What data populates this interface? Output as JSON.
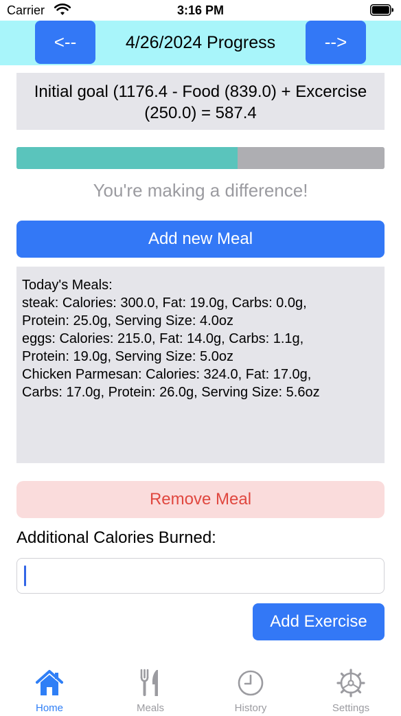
{
  "status_bar": {
    "carrier": "Carrier",
    "time": "3:16 PM"
  },
  "header": {
    "prev_label": "<--",
    "title": "4/26/2024 Progress",
    "next_label": "-->"
  },
  "goal": {
    "line1": "Initial goal (1176.4 - Food (839.0) + Excercise",
    "line2": "(250.0) = 587.4"
  },
  "progress": {
    "fraction": 0.6,
    "fill_color": "#5ac4bc",
    "track_color": "#aeaeb2"
  },
  "motivation": "You're making a difference!",
  "add_meal_label": "Add new Meal",
  "meals": {
    "lines": [
      "Today's Meals:",
      "steak: Calories: 300.0, Fat: 19.0g, Carbs: 0.0g,",
      "Protein: 25.0g, Serving Size: 4.0oz",
      "eggs: Calories: 215.0, Fat: 14.0g, Carbs: 1.1g,",
      "Protein: 19.0g, Serving Size: 5.0oz",
      "Chicken Parmesan: Calories: 324.0, Fat: 17.0g,",
      "Carbs: 17.0g, Protein: 26.0g, Serving Size: 5.6oz"
    ]
  },
  "remove_meal_label": "Remove Meal",
  "burn_label": "Additional Calories Burned:",
  "burn_input": {
    "value": "",
    "placeholder": ""
  },
  "add_exercise_label": "Add Exercise",
  "tabs": [
    {
      "label": "Home",
      "icon": "house-icon",
      "active": true
    },
    {
      "label": "Meals",
      "icon": "fork-knife-icon",
      "active": false
    },
    {
      "label": "History",
      "icon": "clock-icon",
      "active": false
    },
    {
      "label": "Settings",
      "icon": "gear-icon",
      "active": false
    }
  ],
  "colors": {
    "accent": "#3378f6",
    "header_bg": "#a8f5fa",
    "destructive": "#e0473f",
    "tab_active": "#2f7ff6",
    "tab_inactive": "#9b9ba0"
  }
}
